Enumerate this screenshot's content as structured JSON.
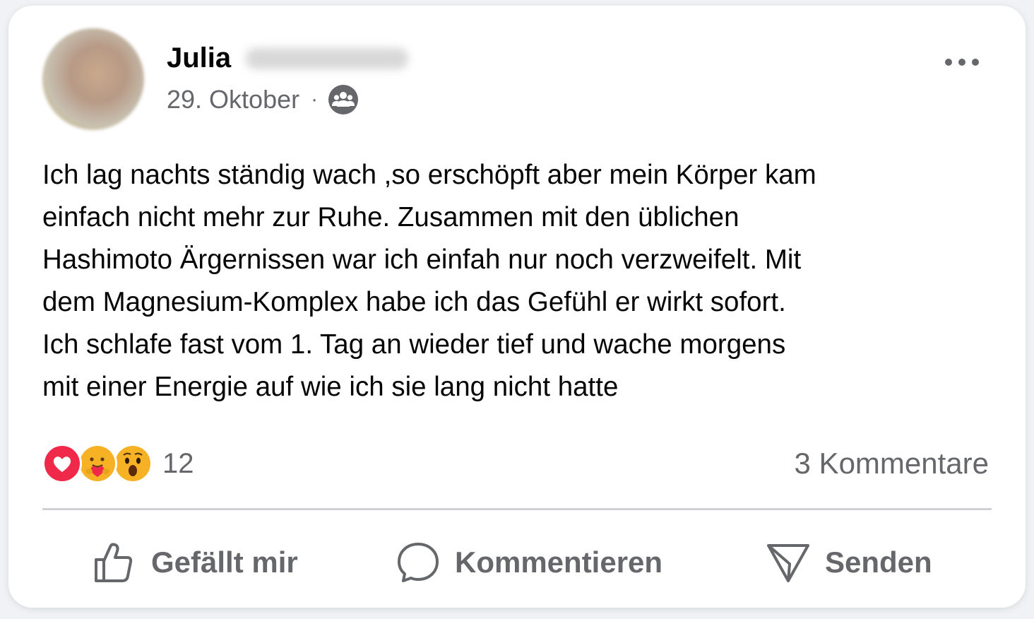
{
  "post": {
    "author_first_name": "Julia",
    "date": "29. Oktober",
    "separator": "·",
    "audience_icon": "friends-icon",
    "more_icon": "more-horizontal-icon",
    "text": "Ich lag nachts ständig wach ,so erschöpft aber mein Körper kam\neinfach nicht mehr zur Ruhe. Zusammen mit den üblichen\nHashimoto Ärgernissen war ich einfah nur noch verzweifelt. Mit\ndem Magnesium-Komplex habe ich das Gefühl er wirkt sofort.\nIch schlafe fast vom 1. Tag an wieder tief und wache morgens\nmit einer Energie auf wie ich sie lang nicht hatte"
  },
  "reactions": {
    "icons": [
      "love-reaction-icon",
      "care-reaction-icon",
      "wow-reaction-icon"
    ],
    "count": "12"
  },
  "comments": {
    "label": "3 Kommentare"
  },
  "actions": {
    "like_label": "Gefällt mir",
    "comment_label": "Kommentieren",
    "send_label": "Senden"
  },
  "colors": {
    "text_primary": "#050505",
    "text_secondary": "#65676b",
    "divider": "#ced0d4",
    "love_red": "#f0284a",
    "emoji_yellow": "#f7b125"
  }
}
